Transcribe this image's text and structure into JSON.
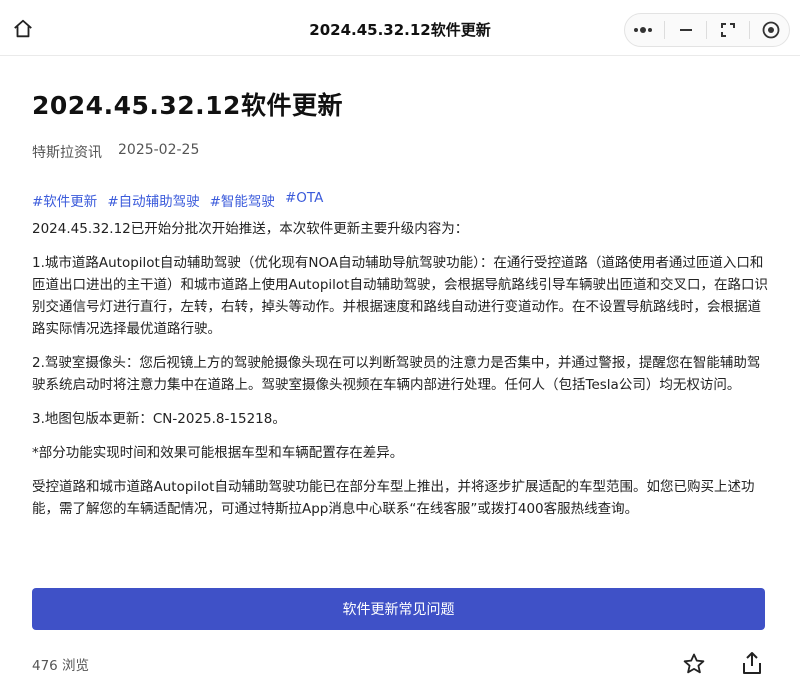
{
  "topbar": {
    "title": "2024.45.32.12软件更新",
    "home_icon": "home-icon",
    "capsule_icons": [
      "more-icon",
      "minimize-icon",
      "restore-icon",
      "close-target-icon"
    ]
  },
  "article": {
    "title": "2024.45.32.12软件更新",
    "source": "特斯拉资讯",
    "date": "2025-02-25",
    "tags": [
      "#软件更新",
      "#自动辅助驾驶",
      "#智能驾驶",
      "#OTA"
    ],
    "intro": "2024.45.32.12已开始分批次开始推送，本次软件更新主要升级内容为：",
    "items": [
      "1.城市道路Autopilot自动辅助驾驶（优化现有NOA自动辅助导航驾驶功能）：在通行受控道路（道路使用者通过匝道入口和匝道出口进出的主干道）和城市道路上使用Autopilot自动辅助驾驶，会根据导航路线引导车辆驶出匝道和交叉口，在路口识别交通信号灯进行直行，左转，右转，掉头等动作。并根据速度和路线自动进行变道动作。在不设置导航路线时，会根据道路实际情况选择最优道路行驶。",
      "2.驾驶室摄像头：您后视镜上方的驾驶舱摄像头现在可以判断驾驶员的注意力是否集中，并通过警报，提醒您在智能辅助驾驶系统启动时将注意力集中在道路上。驾驶室摄像头视频在车辆内部进行处理。任何人（包括Tesla公司）均无权访问。",
      "3.地图包版本更新：CN-2025.8-15218。"
    ],
    "note": "*部分功能实现时间和效果可能根据车型和车辆配置存在差异。",
    "closing": "受控道路和城市道路Autopilot自动辅助驾驶功能已在部分车型上推出，并将逐步扩展适配的车型范围。如您已购买上述功能，需了解您的车辆适配情况，可通过特斯拉App消息中心联系“在线客服”或拨打400客服热线查询。"
  },
  "footer": {
    "faq_button": "软件更新常见问题",
    "views": "476 浏览",
    "star_icon": "star-icon",
    "share_icon": "share-icon"
  },
  "colors": {
    "accent": "#3f51c7",
    "tag": "#3b5bdb"
  }
}
